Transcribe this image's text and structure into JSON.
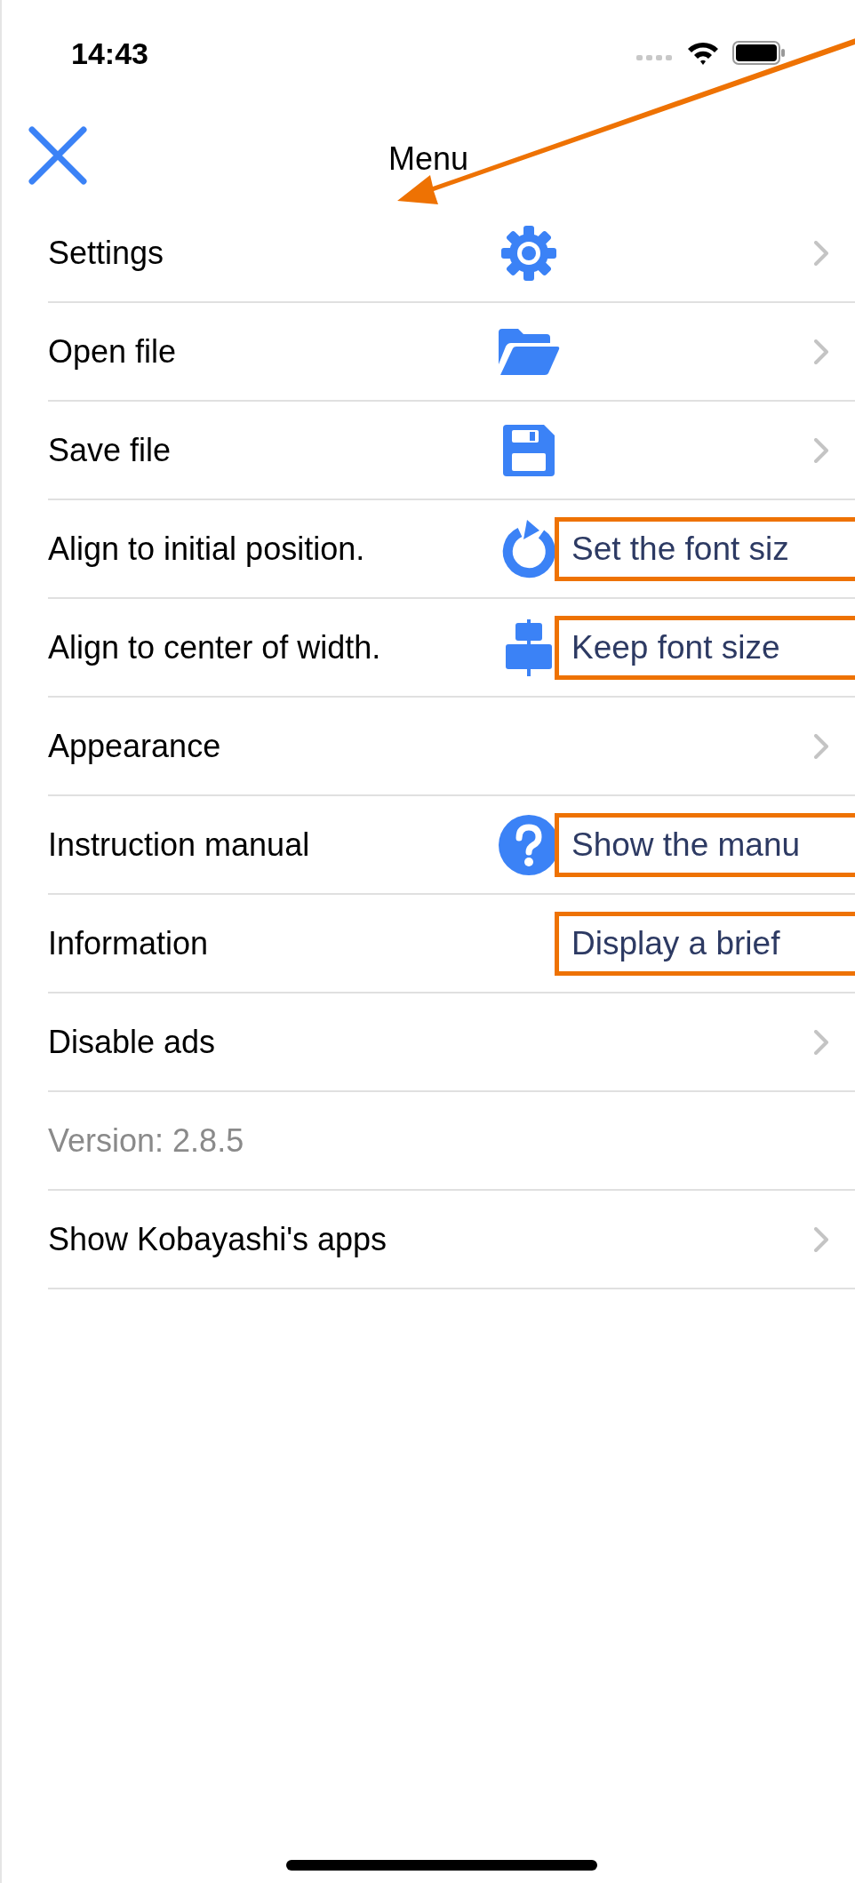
{
  "status_bar": {
    "time": "14:43"
  },
  "nav": {
    "title": "Menu"
  },
  "rows": [
    {
      "label": "Settings",
      "kind": "gear",
      "chevron": true,
      "muted": false
    },
    {
      "label": "Open file",
      "kind": "folder",
      "chevron": true,
      "muted": false
    },
    {
      "label": "Save file",
      "kind": "floppy",
      "chevron": true,
      "muted": false
    },
    {
      "label": "Align to initial position.",
      "kind": "rotate",
      "chevron": false,
      "muted": false,
      "callout": "Set the font siz"
    },
    {
      "label": "Align to center of width.",
      "kind": "align",
      "chevron": false,
      "muted": false,
      "callout": "Keep font size"
    },
    {
      "label": "Appearance",
      "chevron": true,
      "muted": false
    },
    {
      "label": "Instruction manual",
      "kind": "help",
      "chevron": false,
      "muted": false,
      "callout": "Show the manu"
    },
    {
      "label": "Information",
      "chevron": false,
      "muted": false,
      "callout": "Display a brief"
    },
    {
      "label": "Disable ads",
      "chevron": true,
      "muted": false
    },
    {
      "label": "Version: 2.8.5",
      "chevron": false,
      "muted": true
    },
    {
      "label": "Show Kobayashi's apps",
      "chevron": true,
      "muted": false
    }
  ]
}
